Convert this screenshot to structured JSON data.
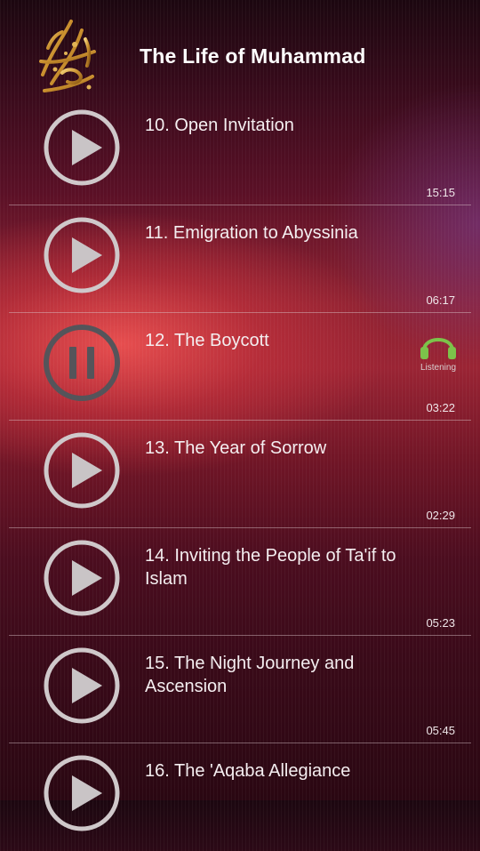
{
  "header": {
    "title": "The Life of Muhammad",
    "logo_icon": "calligraphy-logo-icon"
  },
  "tracks": [
    {
      "title": "10. Open Invitation",
      "duration": "15:15",
      "state": "play"
    },
    {
      "title": "11. Emigration to Abyssinia",
      "duration": "06:17",
      "state": "play"
    },
    {
      "title": "12. The Boycott",
      "duration": "03:22",
      "state": "pause",
      "status": "Listening"
    },
    {
      "title": "13. The Year of Sorrow",
      "duration": "02:29",
      "state": "play"
    },
    {
      "title": "14. Inviting the People of Ta'if to Islam",
      "duration": "05:23",
      "state": "play"
    },
    {
      "title": "15. The Night Journey and Ascension",
      "duration": "05:45",
      "state": "play"
    },
    {
      "title": "16. The 'Aqaba Allegiance",
      "duration": "",
      "state": "play"
    }
  ],
  "colors": {
    "listening_accent": "#7cc24a",
    "button_ring": "#cfc8ca",
    "button_ring_active": "#55545a"
  }
}
